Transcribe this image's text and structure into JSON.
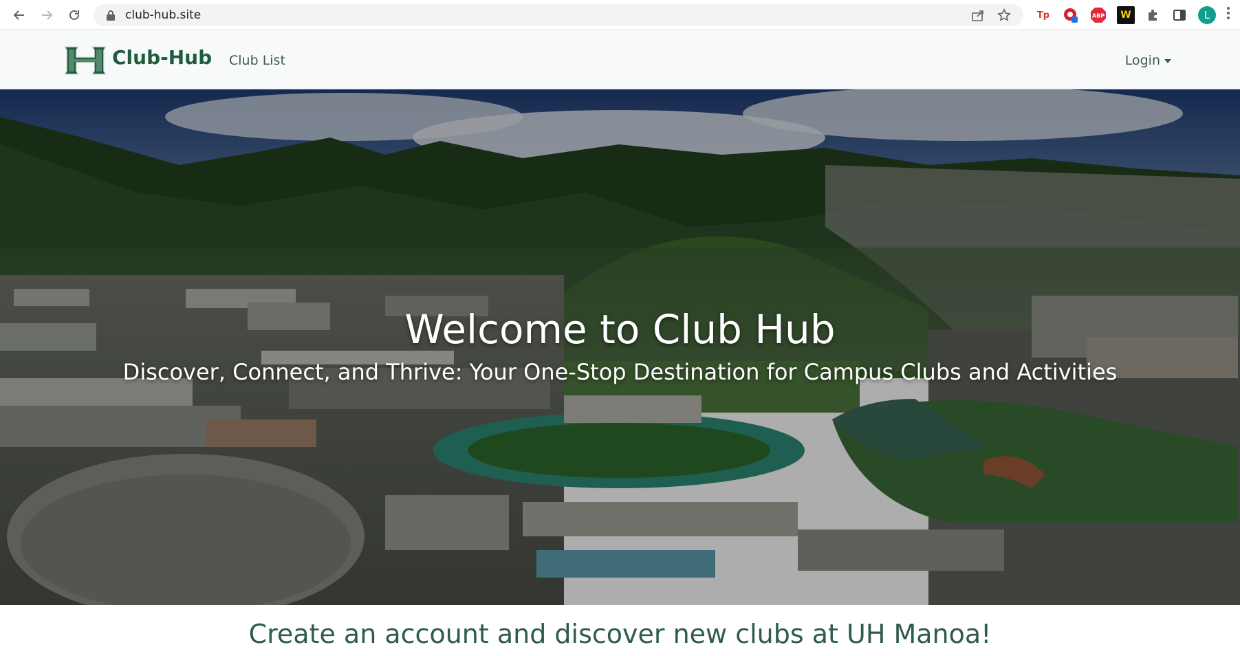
{
  "browser": {
    "url": "club-hub.site",
    "profile_initial": "L",
    "extensions": [
      "Tp",
      "ABP",
      "W"
    ]
  },
  "nav": {
    "brand": "Club-Hub",
    "links": [
      "Club List"
    ],
    "login_label": "Login"
  },
  "hero": {
    "title": "Welcome to Club Hub",
    "subtitle": "Discover, Connect, and Thrive: Your One-Stop Destination for Campus Clubs and Activities"
  },
  "cta": {
    "text": "Create an account and discover new clubs at UH Manoa!"
  },
  "colors": {
    "brand_green": "#1f5c3e",
    "cta_green": "#2f5c48"
  },
  "icons": [
    "back-arrow-icon",
    "forward-arrow-icon",
    "reload-icon",
    "lock-icon",
    "share-icon",
    "star-icon",
    "puzzle-icon",
    "sidepanel-icon",
    "more-vert-icon"
  ]
}
